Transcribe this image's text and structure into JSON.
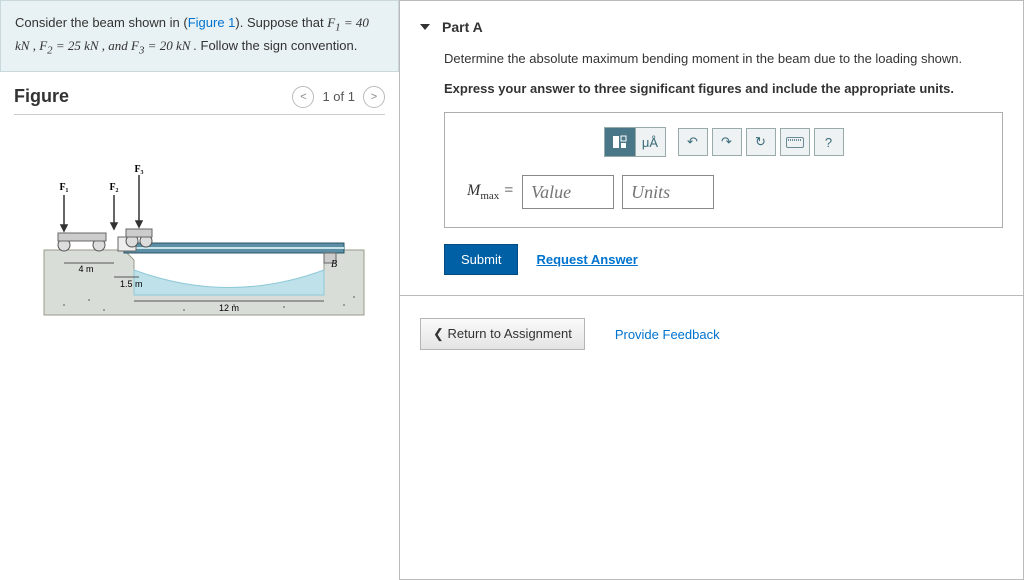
{
  "problem": {
    "prefix_text": "Consider the beam shown in (",
    "figure_link": "Figure 1",
    "after_link": "). Suppose that ",
    "equations": "F1 = 40 kN , F2 = 25 kN , and F3 = 20 kN .",
    "tail": " Follow the sign convention."
  },
  "figure": {
    "title": "Figure",
    "nav": "1 of 1",
    "labels": {
      "f1": "F1",
      "f2": "F2",
      "f3": "F3",
      "b": "B",
      "d4m": "4 m",
      "d15m": "1.5 m",
      "d12m": "12 m"
    }
  },
  "part": {
    "title": "Part A",
    "instruction1": "Determine the absolute maximum bending moment in the beam due to the loading shown.",
    "instruction2": "Express your answer to three significant figures and include the appropriate units.",
    "answer_label_var": "M",
    "answer_label_sub": "max",
    "eq": " = ",
    "value_placeholder": "Value",
    "units_placeholder": "Units",
    "toolbar": {
      "mu": "μÅ",
      "undo": "↶",
      "redo": "↷",
      "reset": "↻",
      "help": "?"
    },
    "submit": "Submit",
    "request": "Request Answer"
  },
  "bottom": {
    "return": "Return to Assignment",
    "feedback": "Provide Feedback"
  }
}
